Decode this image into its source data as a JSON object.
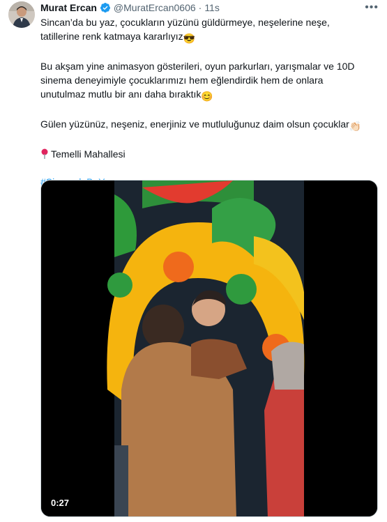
{
  "author": {
    "name": "Murat Ercan",
    "handle": "@MuratErcan0606",
    "separator": "·",
    "time": "11s"
  },
  "icons": {
    "avatar": "avatar",
    "verified": "verified-badge-icon",
    "more": "more-options-icon",
    "pin": "round-pushpin-icon"
  },
  "colors": {
    "verified": "#1d9bf0",
    "hashtag": "#1d9bf0",
    "secondary": "#536471"
  },
  "tweet": {
    "line1": "Sincan’da bu yaz, çocukların yüzünü güldürmeye, neşelerine neşe, tatillerine renk katmaya kararlıyız",
    "emoji1": "😎",
    "line2": "Bu akşam yine animasyon gösterileri, oyun parkurları, yarışmalar ve 10D sinema deneyimiyle çocuklarımızı hem eğlendirdik hem de onlara unutulmaz mutlu bir anı daha bıraktık",
    "emoji2": "😊",
    "line3": "Gülen yüzünüz, neşeniz, enerjiniz ve mutluluğunuz daim olsun çocuklar",
    "emoji3": "👏🏻",
    "location": "Temelli Mahallesi",
    "hashtag": "#SincandaBuYaz"
  },
  "video": {
    "duration": "0:27"
  }
}
